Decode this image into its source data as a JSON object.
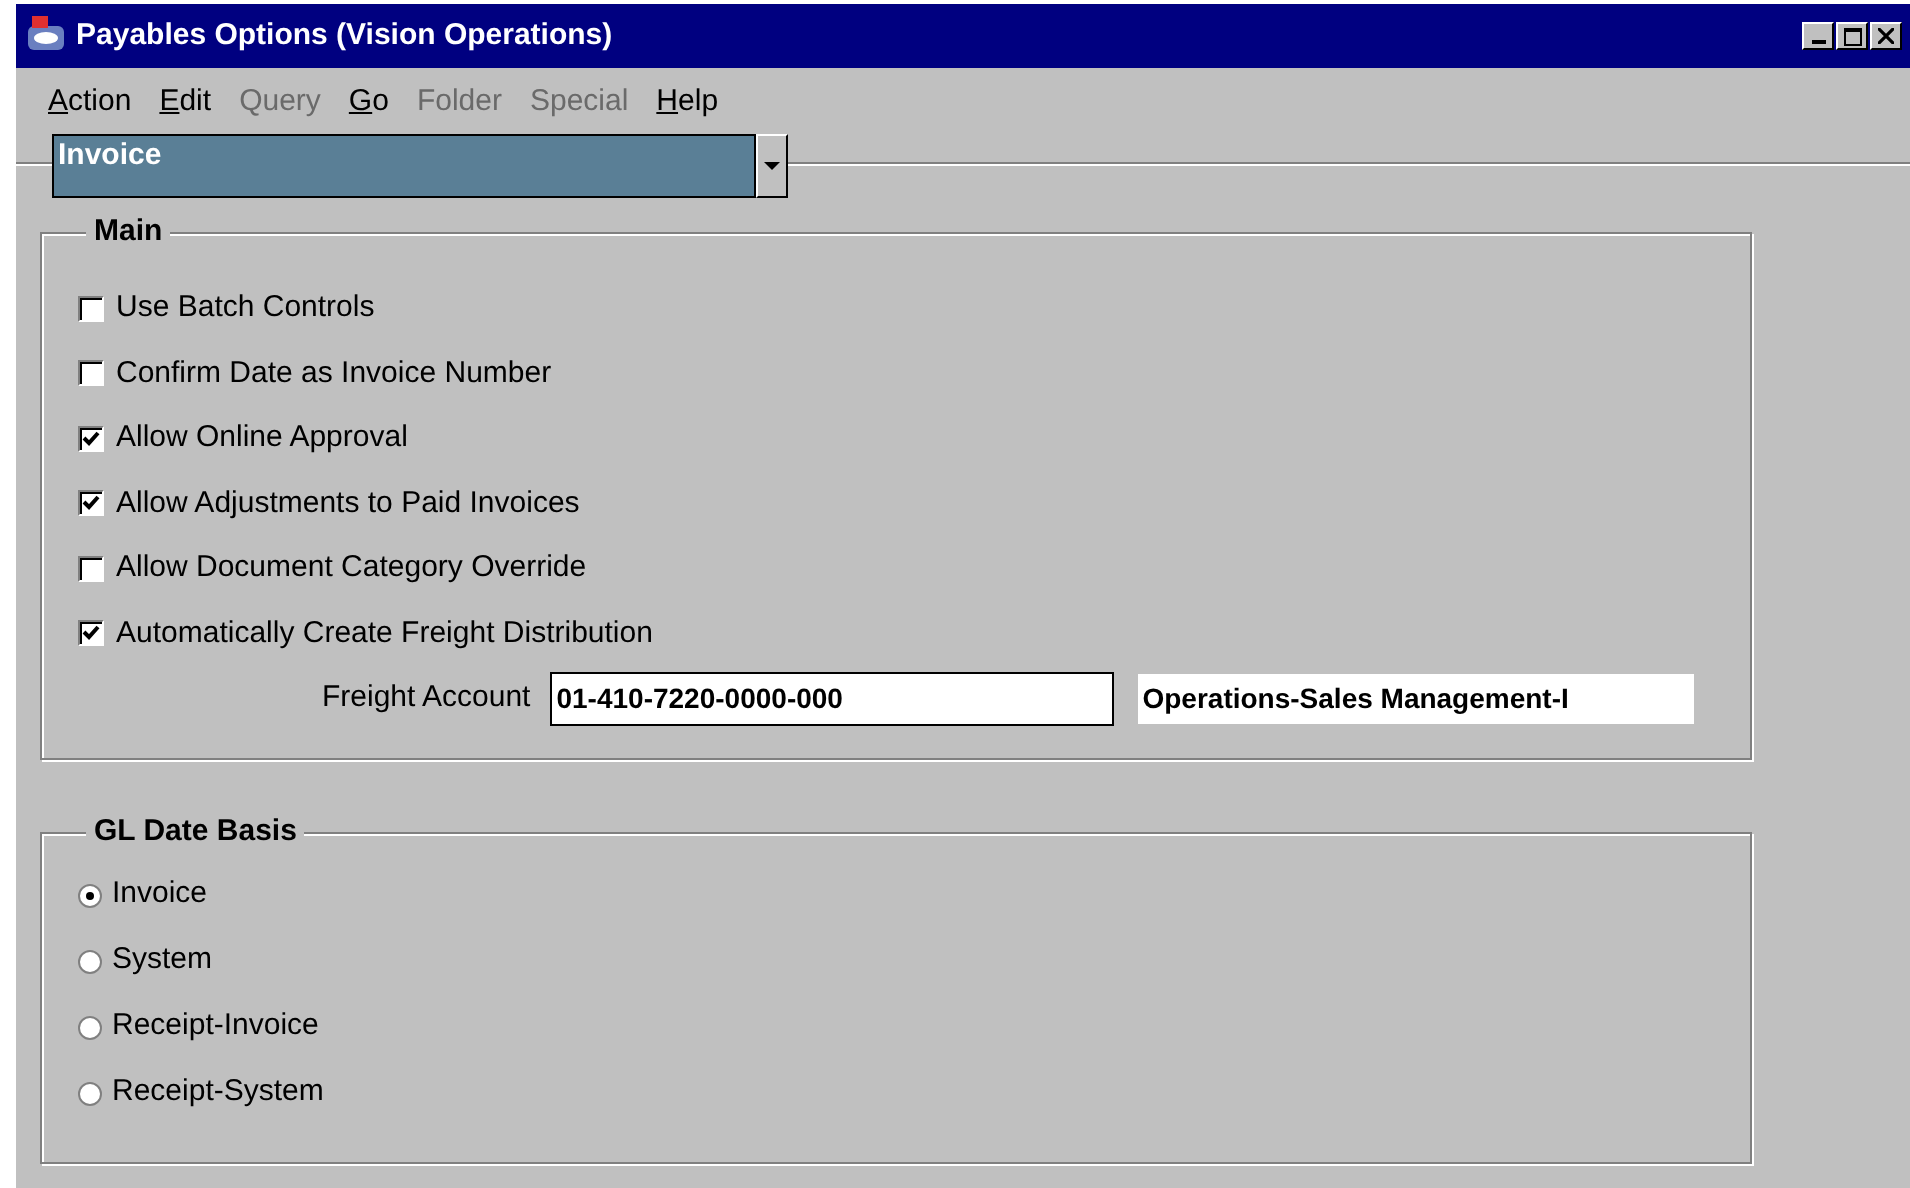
{
  "window": {
    "title": "Payables Options (Vision Operations)"
  },
  "menu": [
    {
      "label": "Action",
      "disabled": false
    },
    {
      "label": "Edit",
      "disabled": false
    },
    {
      "label": "Query",
      "disabled": true
    },
    {
      "label": "Go",
      "disabled": false
    },
    {
      "label": "Folder",
      "disabled": true
    },
    {
      "label": "Special",
      "disabled": true
    },
    {
      "label": "Help",
      "disabled": false
    }
  ],
  "region_selector": {
    "value": "Invoice"
  },
  "main": {
    "title": "Main",
    "options": [
      {
        "label": "Use Batch Controls",
        "checked": false
      },
      {
        "label": "Confirm Date as Invoice Number",
        "checked": false
      },
      {
        "label": "Allow Online Approval",
        "checked": true
      },
      {
        "label": "Allow Adjustments to Paid Invoices",
        "checked": true
      },
      {
        "label": "Allow Document Category Override",
        "checked": false
      },
      {
        "label": "Automatically Create Freight Distribution",
        "checked": true
      }
    ],
    "freight_account": {
      "label": "Freight Account",
      "value": "01-410-7220-0000-000",
      "description": "Operations-Sales Management-I"
    }
  },
  "gl_date_basis": {
    "title": "GL Date Basis",
    "options": [
      {
        "label": "Invoice",
        "selected": true
      },
      {
        "label": "System",
        "selected": false
      },
      {
        "label": "Receipt-Invoice",
        "selected": false
      },
      {
        "label": "Receipt-System",
        "selected": false
      }
    ]
  }
}
